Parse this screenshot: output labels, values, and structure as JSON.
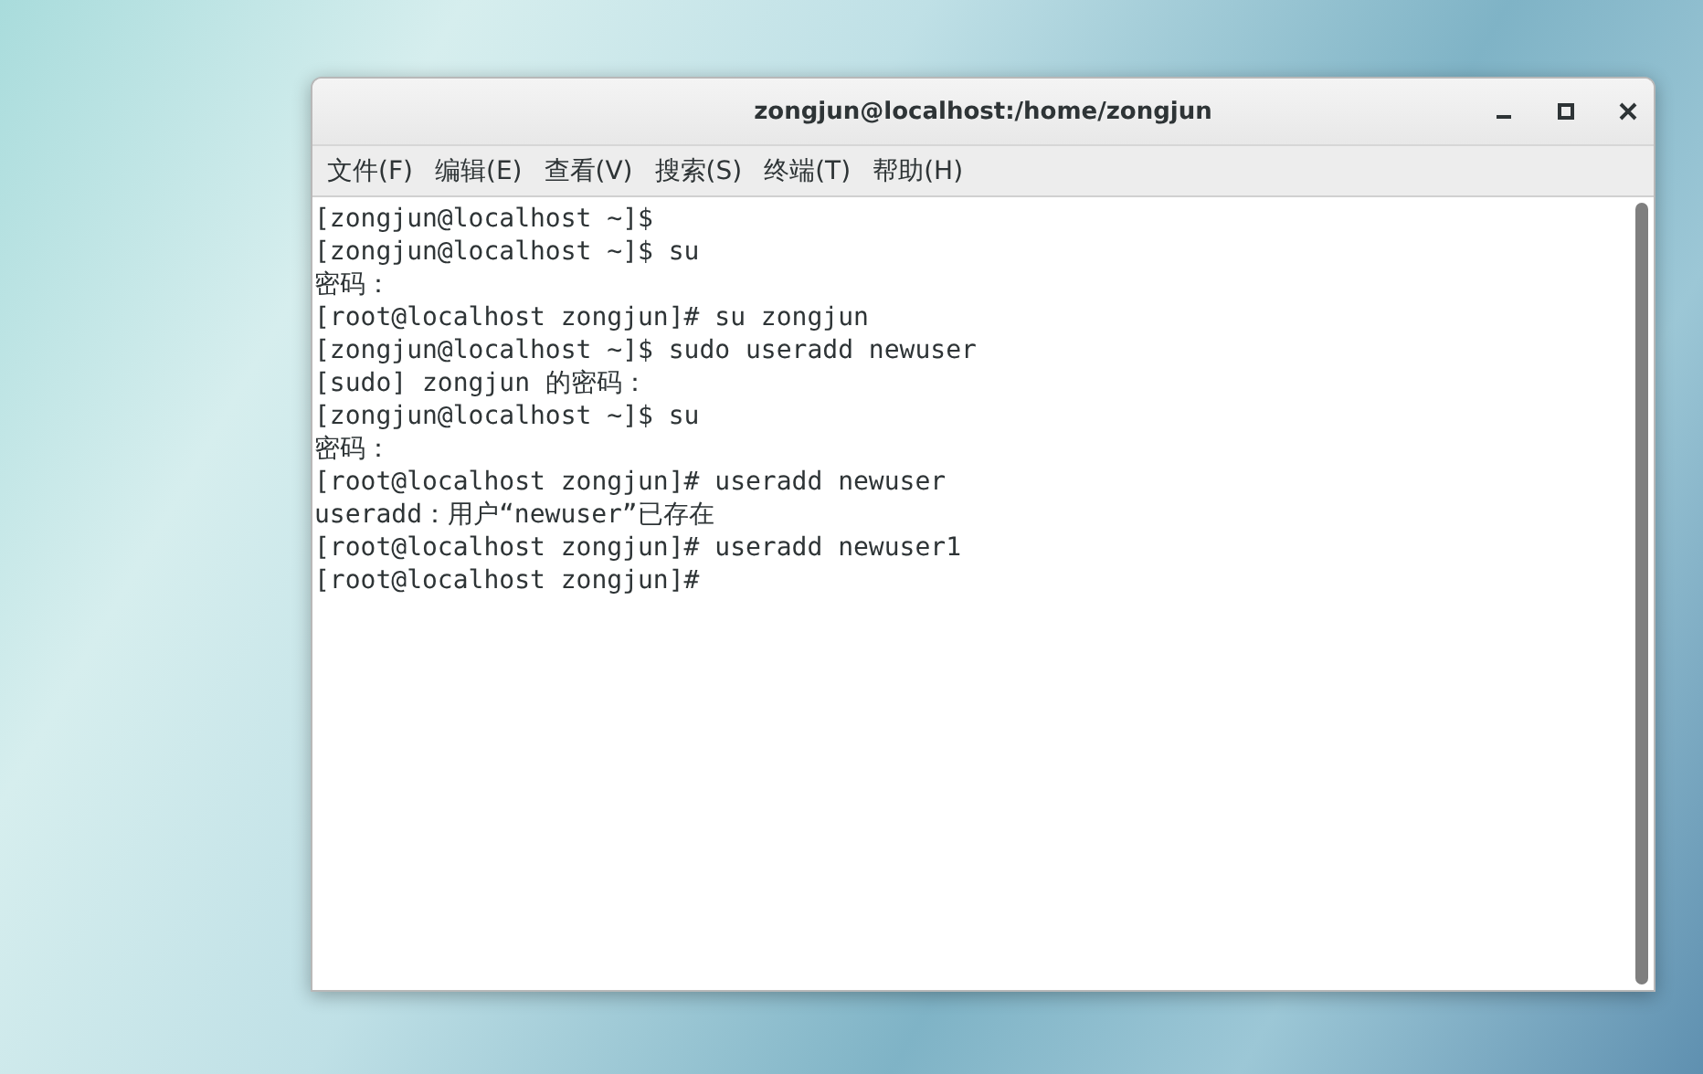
{
  "window": {
    "title": "zongjun@localhost:/home/zongjun"
  },
  "menu": [
    "文件(F)",
    "编辑(E)",
    "查看(V)",
    "搜索(S)",
    "终端(T)",
    "帮助(H)"
  ],
  "terminal": {
    "lines": [
      "[zongjun@localhost ~]$",
      "[zongjun@localhost ~]$ su",
      "密码：",
      "[root@localhost zongjun]# su zongjun",
      "[zongjun@localhost ~]$ sudo useradd newuser",
      "[sudo] zongjun 的密码：",
      "[zongjun@localhost ~]$ su",
      "密码：",
      "[root@localhost zongjun]# useradd newuser",
      "useradd：用户“newuser”已存在",
      "[root@localhost zongjun]# useradd newuser1",
      "[root@localhost zongjun]#"
    ]
  }
}
